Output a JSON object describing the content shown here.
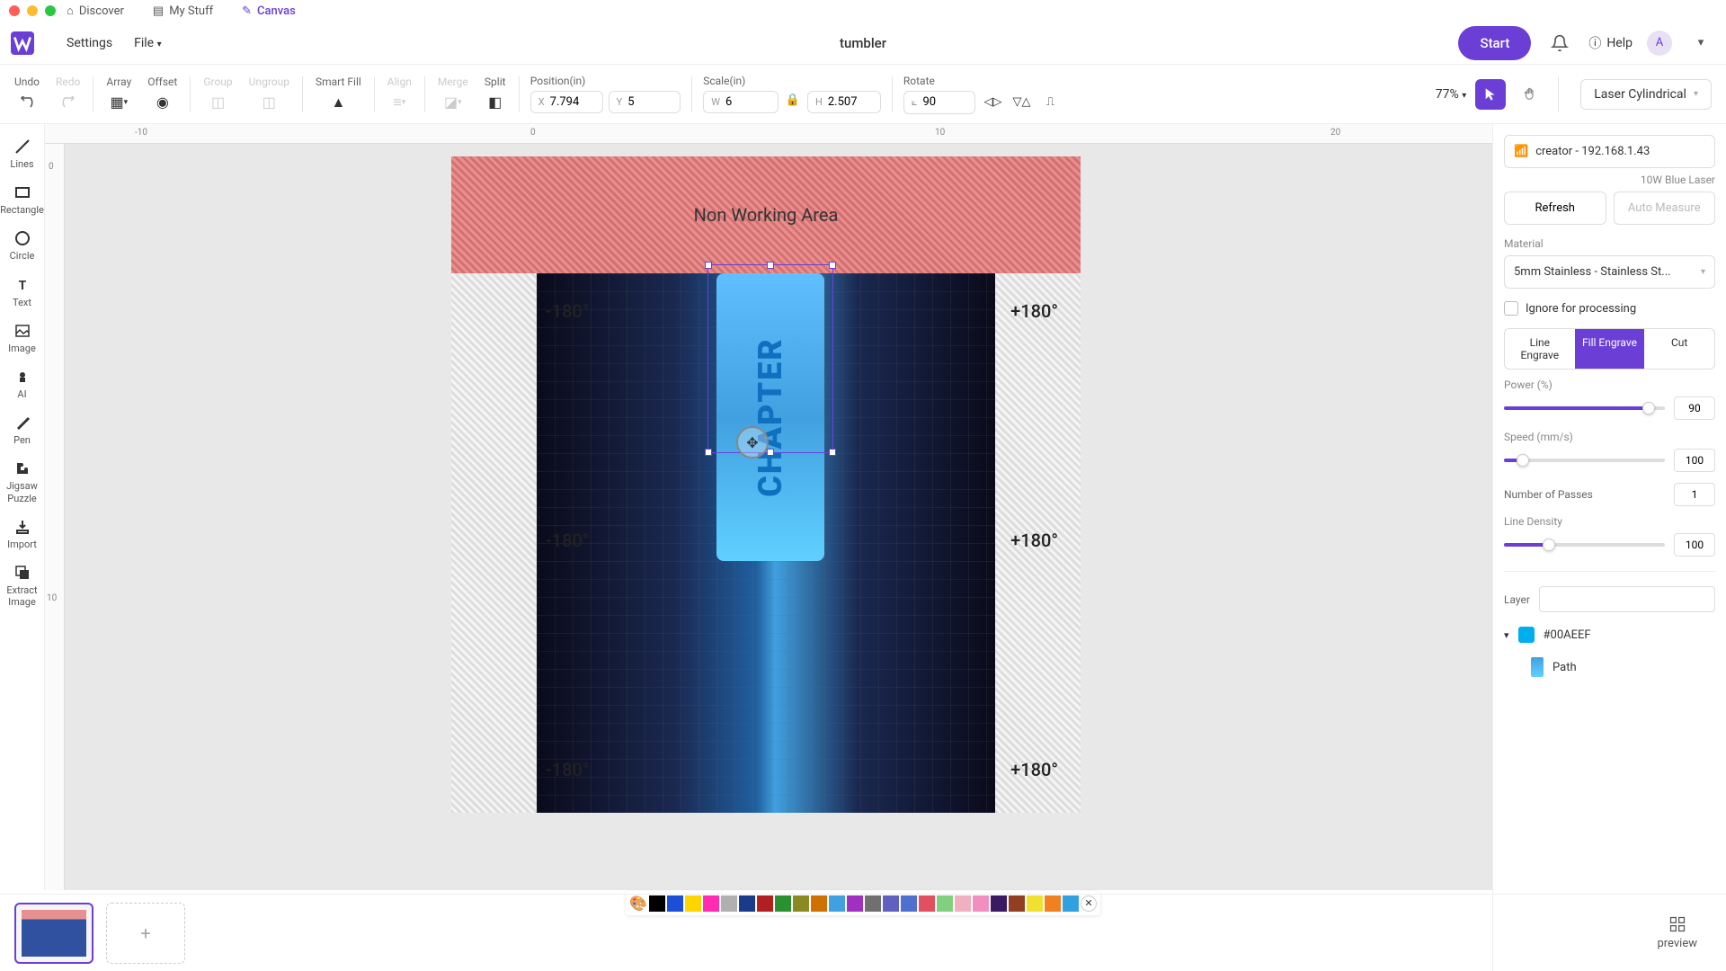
{
  "topTabs": [
    {
      "label": "Discover",
      "icon": "home"
    },
    {
      "label": "My Stuff",
      "icon": "folder"
    },
    {
      "label": "Canvas",
      "icon": "pen",
      "active": true
    }
  ],
  "menu": {
    "settings": "Settings",
    "file": "File"
  },
  "docTitle": "tumbler",
  "startBtn": "Start",
  "help": "Help",
  "avatar": "A",
  "toolbar": {
    "undo": "Undo",
    "redo": "Redo",
    "array": "Array",
    "offset": "Offset",
    "group": "Group",
    "ungroup": "Ungroup",
    "smartFill": "Smart Fill",
    "align": "Align",
    "merge": "Merge",
    "split": "Split",
    "positionLabel": "Position(in)",
    "scaleLabel": "Scale(in)",
    "rotateLabel": "Rotate",
    "x": "7.794",
    "y": "5",
    "w": "6",
    "h": "2.507",
    "rotate": "90",
    "zoom": "77%",
    "modeSelect": "Laser Cylindrical"
  },
  "leftTools": [
    {
      "label": "Lines",
      "icon": "line"
    },
    {
      "label": "Rectangle",
      "icon": "rect"
    },
    {
      "label": "Circle",
      "icon": "circle"
    },
    {
      "label": "Text",
      "icon": "text"
    },
    {
      "label": "Image",
      "icon": "image"
    },
    {
      "label": "AI",
      "icon": "ai"
    },
    {
      "label": "Pen",
      "icon": "pen"
    },
    {
      "label": "Jigsaw Puzzle",
      "icon": "puzzle"
    },
    {
      "label": "Import",
      "icon": "import"
    },
    {
      "label": "Extract Image",
      "icon": "extract"
    }
  ],
  "ruler": {
    "h": [
      "-10",
      "0",
      "10",
      "20"
    ],
    "v": [
      "0",
      "10"
    ]
  },
  "canvas": {
    "nonWorking": "Non Working Area",
    "degLabels": [
      "-180°",
      "+180°",
      "-180°",
      "+180°",
      "-180°",
      "+180°"
    ],
    "tumblerText": "CHAPTER"
  },
  "colors": [
    "#000000",
    "#1a4fd6",
    "#ffd500",
    "#ff2bb1",
    "#b0b0b0",
    "#1a3a8a",
    "#b02020",
    "#2a9030",
    "#8a8a20",
    "#d07000",
    "#40a0e0",
    "#a030c0",
    "#707070",
    "#6060c0",
    "#5070d0",
    "#e05060",
    "#80d080",
    "#f0b0c0",
    "#f090c0",
    "#3a1a60",
    "#904020",
    "#f0e030",
    "#f08020",
    "#30a0e0"
  ],
  "panel": {
    "device": "creator - 192.168.1.43",
    "laser": "10W Blue Laser",
    "refresh": "Refresh",
    "autoMeasure": "Auto Measure",
    "materialLabel": "Material",
    "material": "5mm Stainless - Stainless St...",
    "ignore": "Ignore for processing",
    "modes": [
      "Line Engrave",
      "Fill Engrave",
      "Cut"
    ],
    "activeMode": 1,
    "powerLabel": "Power (%)",
    "power": "90",
    "speedLabel": "Speed (mm/s)",
    "speed": "100",
    "passesLabel": "Number of Passes",
    "passes": "1",
    "densityLabel": "Line Density",
    "density": "100",
    "layerLabel": "Layer",
    "layerColor": "#00AEEF",
    "layerColorHex": "#00AEEF",
    "layerItem": "Path"
  },
  "bottom": {
    "preview": "preview",
    "addPage": "+"
  }
}
